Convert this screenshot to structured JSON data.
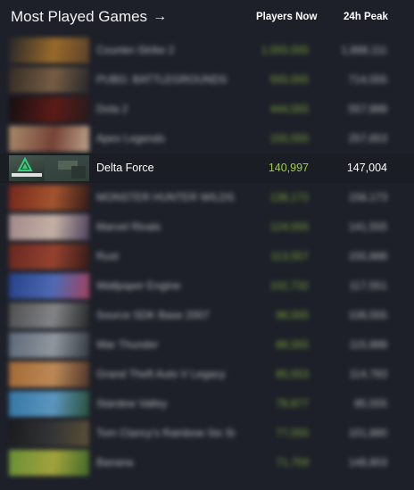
{
  "header": {
    "title": "Most Played Games",
    "players_now_label": "Players Now",
    "peak_label": "24h Peak"
  },
  "rows": [
    {
      "name": "Counter-Strike 2",
      "now": "1,555,555",
      "peak": "1,888,111",
      "colors": [
        "#2a2a2a",
        "#b47a2a",
        "#6a4a2a"
      ]
    },
    {
      "name": "PUBG: BATTLEGROUNDS",
      "now": "555,555",
      "peak": "714,555",
      "colors": [
        "#3a3024",
        "#8a6a4a",
        "#2a2a2a"
      ]
    },
    {
      "name": "Dota 2",
      "now": "444,555",
      "peak": "557,888",
      "colors": [
        "#120c0c",
        "#6a1a14",
        "#2a1a18"
      ]
    },
    {
      "name": "Apex Legends",
      "now": "155,555",
      "peak": "257,653",
      "colors": [
        "#c8a27a",
        "#8a4a3a",
        "#e0c0a0"
      ]
    },
    {
      "name": "Delta Force",
      "now": "140,997",
      "peak": "147,004",
      "focus": true
    },
    {
      "name": "MONSTER HUNTER WILDS",
      "now": "138,172",
      "peak": "158,173",
      "colors": [
        "#8a2a1a",
        "#c06030",
        "#3a1a14"
      ]
    },
    {
      "name": "Marvel Rivals",
      "now": "124,555",
      "peak": "141,555",
      "colors": [
        "#c0a0a0",
        "#e8d0c0",
        "#5a4a6a"
      ]
    },
    {
      "name": "Rust",
      "now": "113,557",
      "peak": "155,888",
      "colors": [
        "#7a2a20",
        "#b04a30",
        "#3a1a14"
      ]
    },
    {
      "name": "Wallpaper Engine",
      "now": "102,732",
      "peak": "117,551",
      "colors": [
        "#2a4aa0",
        "#5a7ad0",
        "#c04a6a"
      ]
    },
    {
      "name": "Source SDK Base 2007",
      "now": "98,555",
      "peak": "108,555",
      "colors": [
        "#5a5a5a",
        "#9a9a9a",
        "#2a2a2a"
      ]
    },
    {
      "name": "War Thunder",
      "now": "88,555",
      "peak": "115,888",
      "colors": [
        "#6a7a8a",
        "#aab0b8",
        "#3a4048"
      ]
    },
    {
      "name": "Grand Theft Auto V Legacy",
      "now": "85,553",
      "peak": "114,783",
      "colors": [
        "#c07a3a",
        "#e0a060",
        "#5a3a2a"
      ]
    },
    {
      "name": "Stardew Valley",
      "now": "78,877",
      "peak": "85,555",
      "colors": [
        "#3a8ac0",
        "#6ab0e0",
        "#2a5a3a"
      ]
    },
    {
      "name": "Tom Clancy's Rainbow Six Si",
      "now": "77,555",
      "peak": "101,880",
      "colors": [
        "#1a1a1a",
        "#3a3a3a",
        "#6a5a3a"
      ]
    },
    {
      "name": "Banana",
      "now": "71,759",
      "peak": "148,803",
      "colors": [
        "#7aa83a",
        "#c0c040",
        "#4a7a2a"
      ]
    }
  ]
}
